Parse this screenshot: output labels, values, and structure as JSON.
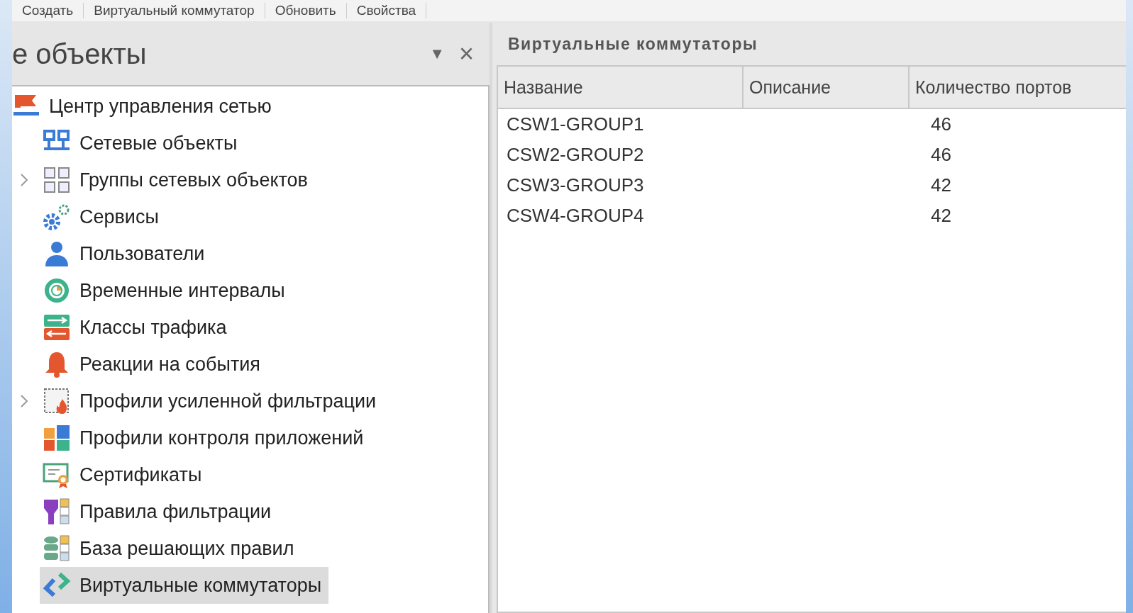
{
  "toolbar": {
    "items": [
      "Создать",
      "Виртуальный коммутатор",
      "Обновить",
      "Свойства"
    ]
  },
  "panel": {
    "title": "е объекты",
    "dropdown": "▼",
    "close": "×"
  },
  "tree": [
    {
      "label": "Центр управления сетью",
      "kind": "flag",
      "selected": false,
      "children": [
        {
          "label": "Сетевые объекты",
          "kind": "network",
          "selected": false
        },
        {
          "label": "Группы сетевых объектов",
          "kind": "groups",
          "selected": false,
          "expanded": false
        },
        {
          "label": "Сервисы",
          "kind": "services",
          "selected": false
        },
        {
          "label": "Пользователи",
          "kind": "users",
          "selected": false
        },
        {
          "label": "Временные интервалы",
          "kind": "schedule",
          "selected": false
        },
        {
          "label": "Классы трафика",
          "kind": "traffic",
          "selected": false
        },
        {
          "label": "Реакции на события",
          "kind": "events",
          "selected": false
        },
        {
          "label": "Профили усиленной фильтрации",
          "kind": "firewall",
          "selected": false,
          "expanded": false
        },
        {
          "label": "Профили контроля приложений",
          "kind": "apps",
          "selected": false
        },
        {
          "label": "Сертификаты",
          "kind": "certificates",
          "selected": false
        },
        {
          "label": "Правила фильтрации",
          "kind": "filter",
          "selected": false
        },
        {
          "label": "База решающих правил",
          "kind": "rules",
          "selected": false
        },
        {
          "label": "Виртуальные коммутаторы",
          "kind": "switches",
          "selected": true
        }
      ]
    }
  ],
  "content": {
    "title": "Виртуальные коммутаторы",
    "table": {
      "columns": [
        "Название",
        "Описание",
        "Количество портов"
      ],
      "rows": [
        [
          "CSW1-GROUP1",
          "",
          "46"
        ],
        [
          "CSW2-GROUP2",
          "",
          "46"
        ],
        [
          "CSW3-GROUP3",
          "",
          "42"
        ],
        [
          "CSW4-GROUP4",
          "",
          "42"
        ]
      ]
    }
  }
}
